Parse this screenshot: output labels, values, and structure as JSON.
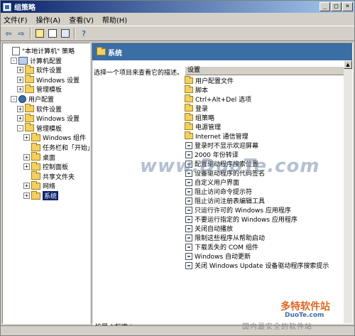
{
  "window": {
    "title": "组策略"
  },
  "menu": [
    {
      "label": "文件(F)"
    },
    {
      "label": "操作(A)"
    },
    {
      "label": "查看(V)"
    },
    {
      "label": "帮助(H)"
    }
  ],
  "tree": [
    {
      "label": "\"本地计算机\" 策略",
      "level": 0,
      "icon": "doc",
      "exp": ""
    },
    {
      "label": "计算机配置",
      "level": 1,
      "icon": "pc",
      "exp": "-"
    },
    {
      "label": "软件设置",
      "level": 2,
      "icon": "folder",
      "exp": "+"
    },
    {
      "label": "Windows 设置",
      "level": 2,
      "icon": "folder",
      "exp": "+"
    },
    {
      "label": "管理模板",
      "level": 2,
      "icon": "folder",
      "exp": "+"
    },
    {
      "label": "用户配置",
      "level": 1,
      "icon": "user",
      "exp": "-"
    },
    {
      "label": "软件设置",
      "level": 2,
      "icon": "folder",
      "exp": "+"
    },
    {
      "label": "Windows 设置",
      "level": 2,
      "icon": "folder",
      "exp": "+"
    },
    {
      "label": "管理模板",
      "level": 2,
      "icon": "folder",
      "exp": "-"
    },
    {
      "label": "Windows 组件",
      "level": 3,
      "icon": "folder",
      "exp": "+"
    },
    {
      "label": "任务栏和「开始」菜单",
      "level": 3,
      "icon": "folder",
      "exp": ""
    },
    {
      "label": "桌面",
      "level": 3,
      "icon": "folder",
      "exp": "+"
    },
    {
      "label": "控制面板",
      "level": 3,
      "icon": "folder",
      "exp": "+"
    },
    {
      "label": "共享文件夹",
      "level": 3,
      "icon": "folder",
      "exp": ""
    },
    {
      "label": "网络",
      "level": 3,
      "icon": "folder",
      "exp": "+"
    },
    {
      "label": "系统",
      "level": 3,
      "icon": "folder",
      "exp": "+",
      "selected": true
    }
  ],
  "right": {
    "title": "系统",
    "description": "选择一个项目来查看它的描述。",
    "column_header": "设置",
    "items": [
      {
        "label": "用户配置文件",
        "icon": "folder"
      },
      {
        "label": "脚本",
        "icon": "folder"
      },
      {
        "label": "Ctrl+Alt+Del 选项",
        "icon": "folder"
      },
      {
        "label": "登录",
        "icon": "folder"
      },
      {
        "label": "组策略",
        "icon": "folder"
      },
      {
        "label": "电源管理",
        "icon": "folder"
      },
      {
        "label": "Internet 通信管理",
        "icon": "folder"
      },
      {
        "label": "登录时不显示欢迎屏幕",
        "icon": "setting"
      },
      {
        "label": "2000 年份转译",
        "icon": "setting"
      },
      {
        "label": "配置驱动程序搜索位置",
        "icon": "setting"
      },
      {
        "label": "设备驱动程序的代码签名",
        "icon": "setting"
      },
      {
        "label": "自定义用户界面",
        "icon": "setting"
      },
      {
        "label": "阻止访问命令提示符",
        "icon": "setting"
      },
      {
        "label": "阻止访问注册表编辑工具",
        "icon": "setting"
      },
      {
        "label": "只运行许可的 Windows 应用程序",
        "icon": "setting"
      },
      {
        "label": "不要运行指定的 Windows 应用程序",
        "icon": "setting"
      },
      {
        "label": "关闭自动播放",
        "icon": "setting"
      },
      {
        "label": "限制这些程序从帮助启动",
        "icon": "setting"
      },
      {
        "label": "下载丢失的 COM 组件",
        "icon": "setting"
      },
      {
        "label": "Windows 自动更新",
        "icon": "setting"
      },
      {
        "label": "关闭 Windows Update 设备驱动程序搜索提示",
        "icon": "setting"
      }
    ]
  },
  "tabs": [
    {
      "label": "扩展"
    },
    {
      "label": "标准"
    }
  ],
  "watermarks": {
    "center": "www.DuoTe.com",
    "logo": "多特软件站",
    "logo_sub": "DuoTe.com",
    "tagline": "国内最安全的软件站"
  }
}
